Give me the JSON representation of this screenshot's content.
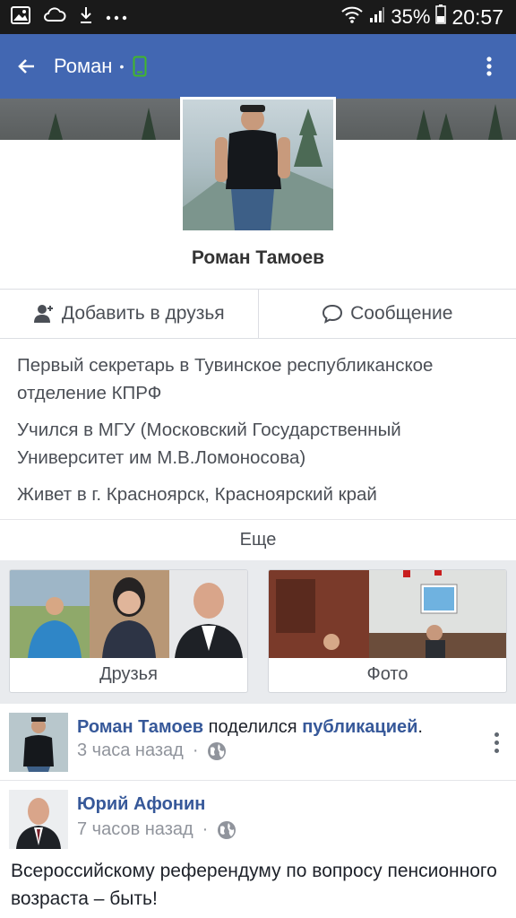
{
  "status_bar": {
    "battery": "35%",
    "time": "20:57",
    "icons": [
      "image-icon",
      "cloud-sync-icon",
      "download-icon",
      "more-dots-icon",
      "wifi-icon",
      "signal-icon",
      "battery-icon"
    ]
  },
  "app_bar": {
    "title": "Роман",
    "dot": "•",
    "icons": [
      "back-arrow-icon",
      "phone-icon",
      "overflow-menu-icon"
    ],
    "accent": "#4267b2",
    "online_color": "#42b72a"
  },
  "profile": {
    "name": "Роман Тамоев"
  },
  "actions": {
    "add_friend": "Добавить в друзья",
    "message": "Сообщение"
  },
  "info": {
    "work": "Первый секретарь в Тувинское республиканское отделение КПРФ",
    "education": "Учился в МГУ (Московский Государственный Университет им М.В.Ломоносова)",
    "lives": "Живет в г. Красноярск, Красноярский край"
  },
  "more_label": "Еще",
  "cards": {
    "friends": "Друзья",
    "photos": "Фото"
  },
  "posts": [
    {
      "author": "Роман Тамоев",
      "verb": " поделился ",
      "object": "публикацией",
      "end": ".",
      "time": "3 часа назад",
      "sep": "·"
    },
    {
      "author": "Юрий Афонин",
      "time": "7 часов назад",
      "sep": "·",
      "text": "Всероссийскому референдуму по вопросу пенсионного возраста – быть!"
    }
  ]
}
